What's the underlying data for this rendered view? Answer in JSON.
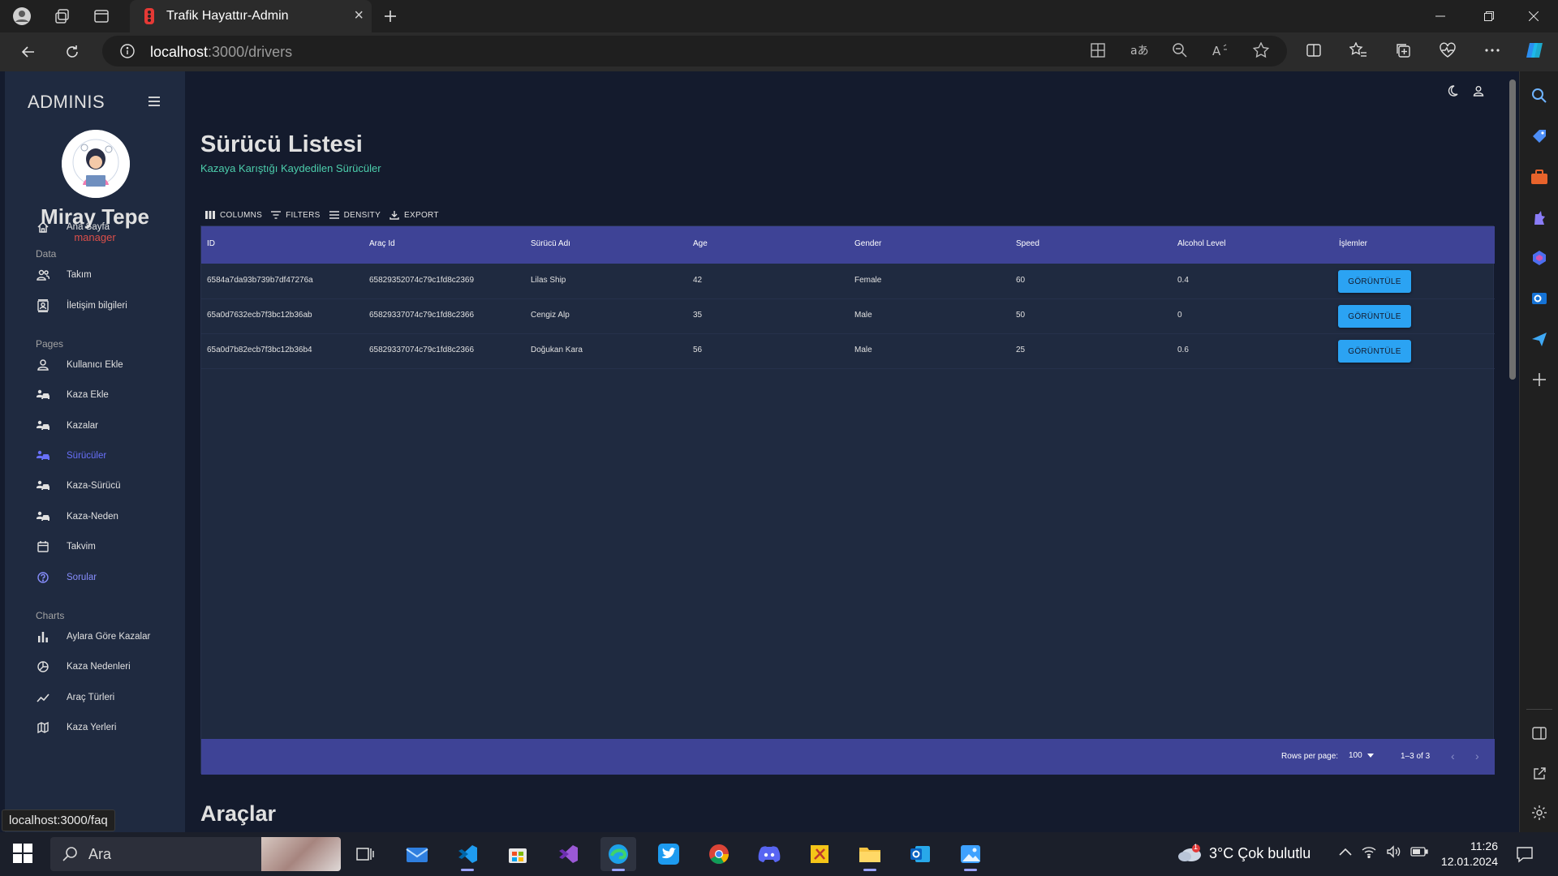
{
  "browser": {
    "tab_title": "Trafik Hayattır-Admin",
    "url_host": "localhost",
    "url_path": ":3000/drivers",
    "status_url": "localhost:3000/faq"
  },
  "sidebar": {
    "brand": "ADMINIS",
    "user_name": "Miray Tepe",
    "user_role": "manager",
    "sections": {
      "data": "Data",
      "pages": "Pages",
      "charts": "Charts"
    },
    "items": [
      {
        "label": "Ana Sayfa",
        "icon": "home-icon"
      },
      {
        "label": "Takım",
        "icon": "people-icon"
      },
      {
        "label": "İletişim bilgileri",
        "icon": "contacts-icon"
      },
      {
        "label": "Kullanıcı Ekle",
        "icon": "person-icon"
      },
      {
        "label": "Kaza Ekle",
        "icon": "car-person-icon"
      },
      {
        "label": "Kazalar",
        "icon": "car-person-icon"
      },
      {
        "label": "Sürücüler",
        "icon": "car-person-icon"
      },
      {
        "label": "Kaza-Sürücü",
        "icon": "car-person-icon"
      },
      {
        "label": "Kaza-Neden",
        "icon": "car-person-icon"
      },
      {
        "label": "Takvim",
        "icon": "calendar-icon"
      },
      {
        "label": "Sorular",
        "icon": "help-icon"
      },
      {
        "label": "Aylara Göre Kazalar",
        "icon": "bar-chart-icon"
      },
      {
        "label": "Kaza Nedenleri",
        "icon": "pie-chart-icon"
      },
      {
        "label": "Araç Türleri",
        "icon": "line-chart-icon"
      },
      {
        "label": "Kaza Yerleri",
        "icon": "map-icon"
      }
    ]
  },
  "main": {
    "title": "Sürücü Listesi",
    "subtitle": "Kazaya Karıştığı Kaydedilen Sürücüler",
    "toolbar": {
      "columns": "COLUMNS",
      "filters": "FILTERS",
      "density": "DENSITY",
      "export": "EXPORT"
    },
    "columns": [
      "ID",
      "Araç Id",
      "Sürücü Adı",
      "Age",
      "Gender",
      "Speed",
      "Alcohol Level",
      "İşlemler"
    ],
    "rows": [
      {
        "id": "6584a7da93b739b7df47276a",
        "vehicle_id": "65829352074c79c1fd8c2369",
        "name": "Lilas Ship",
        "age": "42",
        "gender": "Female",
        "speed": "60",
        "alcohol": "0.4",
        "action": "GÖRÜNTÜLE"
      },
      {
        "id": "65a0d7632ecb7f3bc12b36ab",
        "vehicle_id": "65829337074c79c1fd8c2366",
        "name": "Cengiz Alp",
        "age": "35",
        "gender": "Male",
        "speed": "50",
        "alcohol": "0",
        "action": "GÖRÜNTÜLE"
      },
      {
        "id": "65a0d7b82ecb7f3bc12b36b4",
        "vehicle_id": "65829337074c79c1fd8c2366",
        "name": "Doğukan Kara",
        "age": "56",
        "gender": "Male",
        "speed": "25",
        "alcohol": "0.6",
        "action": "GÖRÜNTÜLE"
      }
    ],
    "footer": {
      "rows_per_page_label": "Rows per page:",
      "rows_per_page_value": "100",
      "pagination": "1–3 of 3"
    },
    "next_section_title": "Araçlar"
  },
  "taskbar": {
    "search_label": "Ara",
    "weather": "3°C  Çok bulutlu",
    "time": "11:26",
    "date": "12.01.2024",
    "weather_badge": "1"
  },
  "colors": {
    "primary_bg": "#141b2d",
    "sidebar_bg": "#1f2a40",
    "grid_header": "#3e4396",
    "accent_green": "#4cceac",
    "accent_blue": "#2ba3f3",
    "active_item": "#6870fa",
    "role_red": "#db4f4a"
  }
}
